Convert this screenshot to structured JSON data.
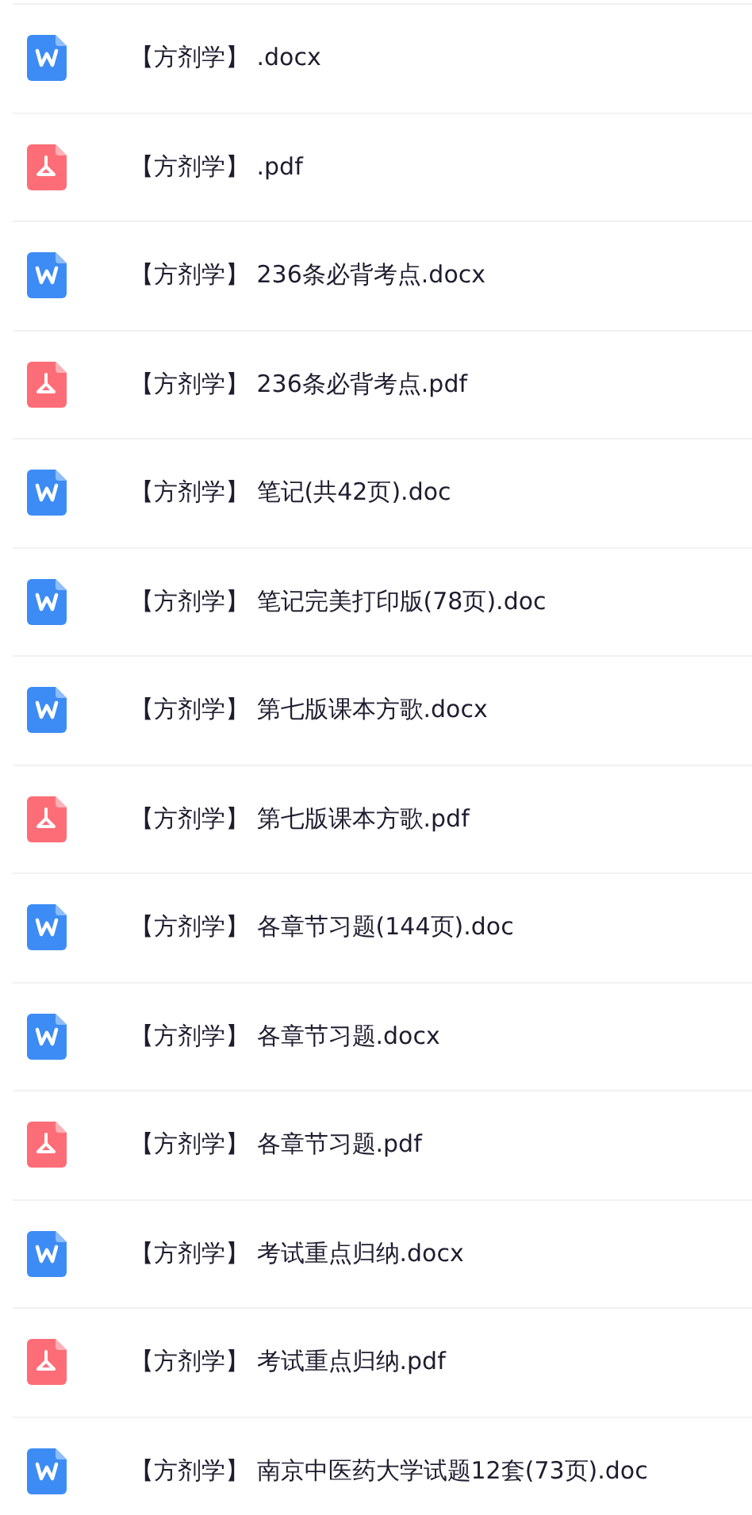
{
  "files": [
    {
      "kind": "word",
      "name": "【方剂学】 .docx"
    },
    {
      "kind": "pdf",
      "name": "【方剂学】 .pdf"
    },
    {
      "kind": "word",
      "name": "【方剂学】 236条必背考点.docx"
    },
    {
      "kind": "pdf",
      "name": "【方剂学】 236条必背考点.pdf"
    },
    {
      "kind": "word",
      "name": "【方剂学】 笔记(共42页).doc"
    },
    {
      "kind": "word",
      "name": "【方剂学】 笔记完美打印版(78页).doc"
    },
    {
      "kind": "word",
      "name": "【方剂学】 第七版课本方歌.docx"
    },
    {
      "kind": "pdf",
      "name": "【方剂学】 第七版课本方歌.pdf"
    },
    {
      "kind": "word",
      "name": "【方剂学】 各章节习题(144页).doc"
    },
    {
      "kind": "word",
      "name": "【方剂学】 各章节习题.docx"
    },
    {
      "kind": "pdf",
      "name": "【方剂学】 各章节习题.pdf"
    },
    {
      "kind": "word",
      "name": "【方剂学】 考试重点归纳.docx"
    },
    {
      "kind": "pdf",
      "name": "【方剂学】 考试重点归纳.pdf"
    },
    {
      "kind": "word",
      "name": "【方剂学】 南京中医药大学试题12套(73页).doc"
    }
  ]
}
